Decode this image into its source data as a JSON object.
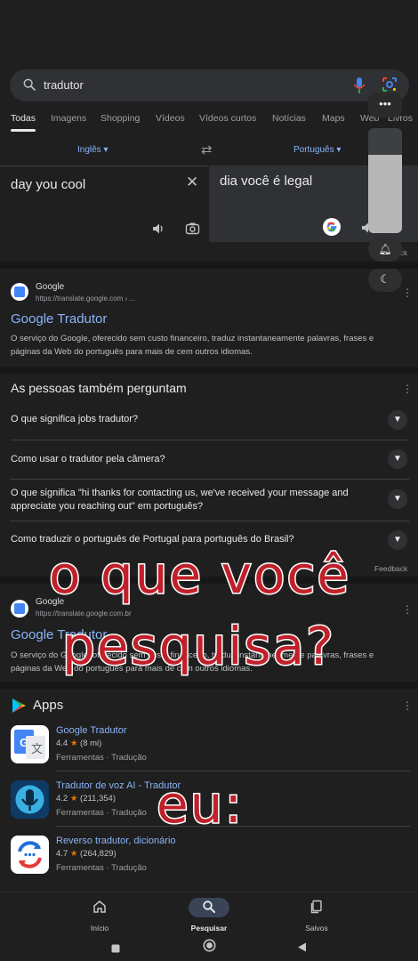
{
  "search": {
    "query": "tradutor"
  },
  "tabs": [
    "Todas",
    "Imagens",
    "Shopping",
    "Vídeos",
    "Vídeos curtos",
    "Notícias",
    "Maps",
    "Web",
    "Livros"
  ],
  "translator": {
    "source_lang": "Inglês",
    "target_lang": "Português",
    "source_text": "day you cool",
    "translated_text": "dia você é legal",
    "feedback_partial": "ck"
  },
  "side_panel": {
    "slider_level": 0.75
  },
  "result1": {
    "site": "Google",
    "url": "https://translate.google.com › ...",
    "title": "Google Tradutor",
    "snippet": "O serviço do Google, oferecido sem custo financeiro, traduz instantaneamente palavras, frases e páginas da Web do português para mais de cem outros idiomas."
  },
  "paa": {
    "title": "As pessoas também perguntam",
    "items": [
      "O que significa jobs tradutor?",
      "Como usar o tradutor pela câmera?",
      "O que significa \"hi thanks for contacting us, we've received your message and appreciate you reaching out\" em português?",
      "Como traduzir o português de Portugal para português do Brasil?"
    ],
    "feedback": "Feedback"
  },
  "result2": {
    "site": "Google",
    "url": "https://translate.google.com.br",
    "title": "Google Tradutor",
    "snippet": "O serviço do Google, oferecido sem custo financeiro, traduz instantaneamente palavras, frases e páginas da Web do português para mais de cem outros idiomas."
  },
  "apps": {
    "title": "Apps",
    "items": [
      {
        "name": "Google Tradutor",
        "rating": "4.4",
        "reviews": "(8 mi)",
        "category": "Ferramentas · Tradução"
      },
      {
        "name": "Tradutor de voz AI - Tradutor",
        "rating": "4.2",
        "reviews": "(211,354)",
        "category": "Ferramentas · Tradução"
      },
      {
        "name": "Reverso tradutor, dicionário",
        "rating": "4.7",
        "reviews": "(264,829)",
        "category": "Ferramentas · Tradução"
      }
    ]
  },
  "overlay": {
    "line1": "o que você",
    "line2": "pesquisa?",
    "line3": "eu:"
  },
  "bottom_nav": {
    "home": "Início",
    "search": "Pesquisar",
    "saved": "Salvos"
  }
}
